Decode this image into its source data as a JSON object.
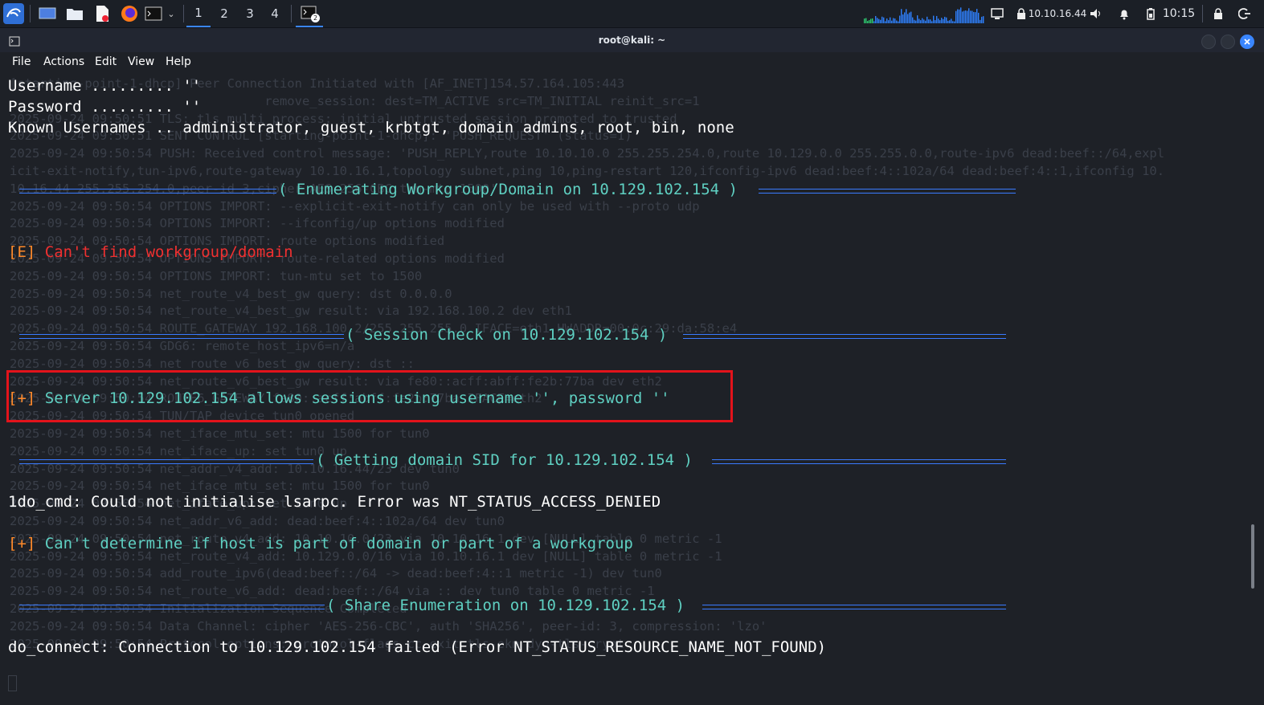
{
  "taskbar": {
    "workspaces": [
      "1",
      "2",
      "3",
      "4"
    ],
    "active_workspace": "1",
    "terminal_badge": "2",
    "ip": "10.10.16.44",
    "clock": "10:15"
  },
  "window": {
    "title": "root@kali: ~",
    "menu": [
      "File",
      "Actions",
      "Edit",
      "View",
      "Help"
    ]
  },
  "background_log": [
    "[starting-point-1-dhcp] Peer Connection Initiated with [AF_INET]154.57.164.105:443",
    "                                  remove_session: dest=TM_ACTIVE src=TM_INITIAL reinit_src=1",
    "2025-09-24 09:50:51 TLS: tls_multi_process: initial untrusted session promoted to trusted",
    "2025-09-24 09:50:51 SENT CONTROL [starting-point-1-dhcp]: 'PUSH_REQUEST' (status=1)",
    "2025-09-24 09:50:54 PUSH: Received control message: 'PUSH_REPLY,route 10.10.10.0 255.255.254.0,route 10.129.0.0 255.255.0.0,route-ipv6 dead:beef::/64,expl",
    "icit-exit-notify,tun-ipv6,route-gateway 10.10.16.1,topology subnet,ping 10,ping-restart 120,ifconfig-ipv6 dead:beef:4::102a/64 dead:beef:4::1,ifconfig 10.",
    "10.16.44 255.255.254.0,peer-id 3,cipher AES-256-CBC,tun-mtu 1500'",
    "2025-09-24 09:50:54 OPTIONS IMPORT: --explicit-exit-notify can only be used with --proto udp",
    "2025-09-24 09:50:54 OPTIONS IMPORT: --ifconfig/up options modified",
    "2025-09-24 09:50:54 OPTIONS IMPORT: route options modified",
    "2025-09-24 09:50:54 OPTIONS IMPORT: route-related options modified",
    "2025-09-24 09:50:54 OPTIONS IMPORT: tun-mtu set to 1500",
    "2025-09-24 09:50:54 net_route_v4_best_gw query: dst 0.0.0.0",
    "2025-09-24 09:50:54 net_route_v4_best_gw result: via 192.168.100.2 dev eth1",
    "2025-09-24 09:50:54 ROUTE_GATEWAY 192.168.100.2/255.255.255.0 IFACE=eth1 HWADDR=00:0c:29:da:58:e4",
    "2025-09-24 09:50:54 GDG6: remote_host_ipv6=n/a",
    "2025-09-24 09:50:54 net_route_v6_best_gw query: dst ::",
    "2025-09-24 09:50:54 net_route_v6_best_gw result: via fe80::acff:abff:fe2b:77ba dev eth2",
    "2025-09-24 09:50:54 ROUTE6_GATEWAY fe80::acff:abff:fe2b:77ba IFACE=eth2",
    "2025-09-24 09:50:54 TUN/TAP device tun0 opened",
    "2025-09-24 09:50:54 net_iface_mtu_set: mtu 1500 for tun0",
    "2025-09-24 09:50:54 net_iface_up: set tun0 up",
    "2025-09-24 09:50:54 net_addr_v4_add: 10.10.16.44/23 dev tun0",
    "2025-09-24 09:50:54 net_iface_mtu_set: mtu 1500 for tun0",
    "2025-09-24 09:50:54 net_iface_up: set tun0 up",
    "2025-09-24 09:50:54 net_addr_v6_add: dead:beef:4::102a/64 dev tun0",
    "2025-09-24 09:50:54 net_route_v4_add: 10.10.10.0/23 via 10.10.16.1 dev [NULL] table 0 metric -1",
    "2025-09-24 09:50:54 net_route_v4_add: 10.129.0.0/16 via 10.10.16.1 dev [NULL] table 0 metric -1",
    "2025-09-24 09:50:54 add_route_ipv6(dead:beef::/64 -> dead:beef:4::1 metric -1) dev tun0",
    "2025-09-24 09:50:54 net_route_v6_add: dead:beef::/64 via :: dev tun0 table 0 metric -1",
    "2025-09-24 09:50:54 Initialization Sequence Completed",
    "2025-09-24 09:50:54 Data Channel: cipher 'AES-256-CBC', auth 'SHA256', peer-id: 3, compression: 'lzo'",
    "2025-09-24 09:50:54 Protocol options: protocol-flags cc-exit tls-ekm dyn-tls-crypt"
  ],
  "terminal": {
    "line_username": "Username ......... ''",
    "line_password": "Password ......... ''",
    "line_known": "Known Usernames .. administrator, guest, krbtgt, domain admins, root, bin, none",
    "header_workgroup": "( Enumerating Workgroup/Domain on 10.129.102.154 )",
    "err_tag": "[E]",
    "err_text": " Can't find workgroup/domain",
    "header_session": "( Session Check on 10.129.102.154 )",
    "ok_tag": "[+]",
    "session_text": " Server 10.129.102.154 allows sessions using username '', password ''",
    "header_sid": "( Getting domain SID for 10.129.102.154 )",
    "lsarpc": "1do_cmd: Could not initialise lsarpc. Error was NT_STATUS_ACCESS_DENIED",
    "domain_text": " Can't determine if host is part of domain or part of a workgroup",
    "header_share": "( Share Enumeration on 10.129.102.154 )",
    "connect": "do_connect: Connection to 10.129.102.154 failed (Error NT_STATUS_RESOURCE_NAME_NOT_FOUND)"
  }
}
